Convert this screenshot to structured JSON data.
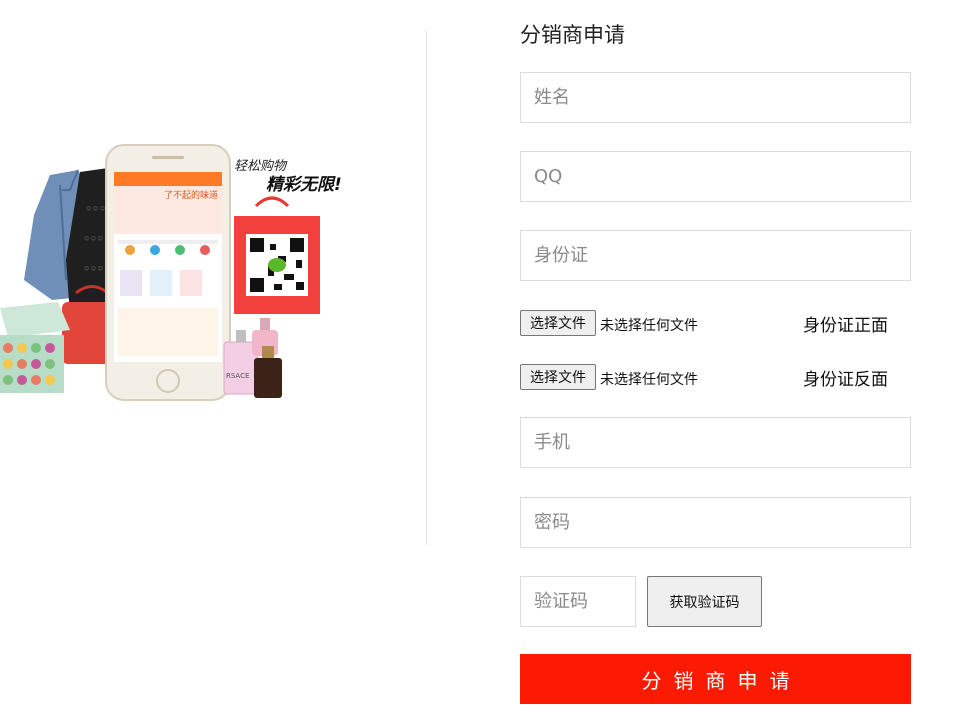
{
  "form": {
    "title": "分销商申请",
    "name_placeholder": "姓名",
    "qq_placeholder": "QQ",
    "id_placeholder": "身份证",
    "phone_placeholder": "手机",
    "password_placeholder": "密码",
    "code_placeholder": "验证码",
    "get_code_label": "获取验证码",
    "submit_label": "分销商申请"
  },
  "uploads": [
    {
      "button_label": "选择文件",
      "status": "未选择任何文件",
      "label": "身份证正面"
    },
    {
      "button_label": "选择文件",
      "status": "未选择任何文件",
      "label": "身份证反面"
    }
  ],
  "illustration": {
    "slogan_line1": "轻松购物",
    "slogan_line2": "精彩无限!",
    "phone_banner": "了不起的味道",
    "perfume_brand": "RSACE",
    "colors": {
      "accent_red": "#fc1b02",
      "phone_orange": "#ff7a25",
      "bag_red": "#f2413c"
    }
  }
}
